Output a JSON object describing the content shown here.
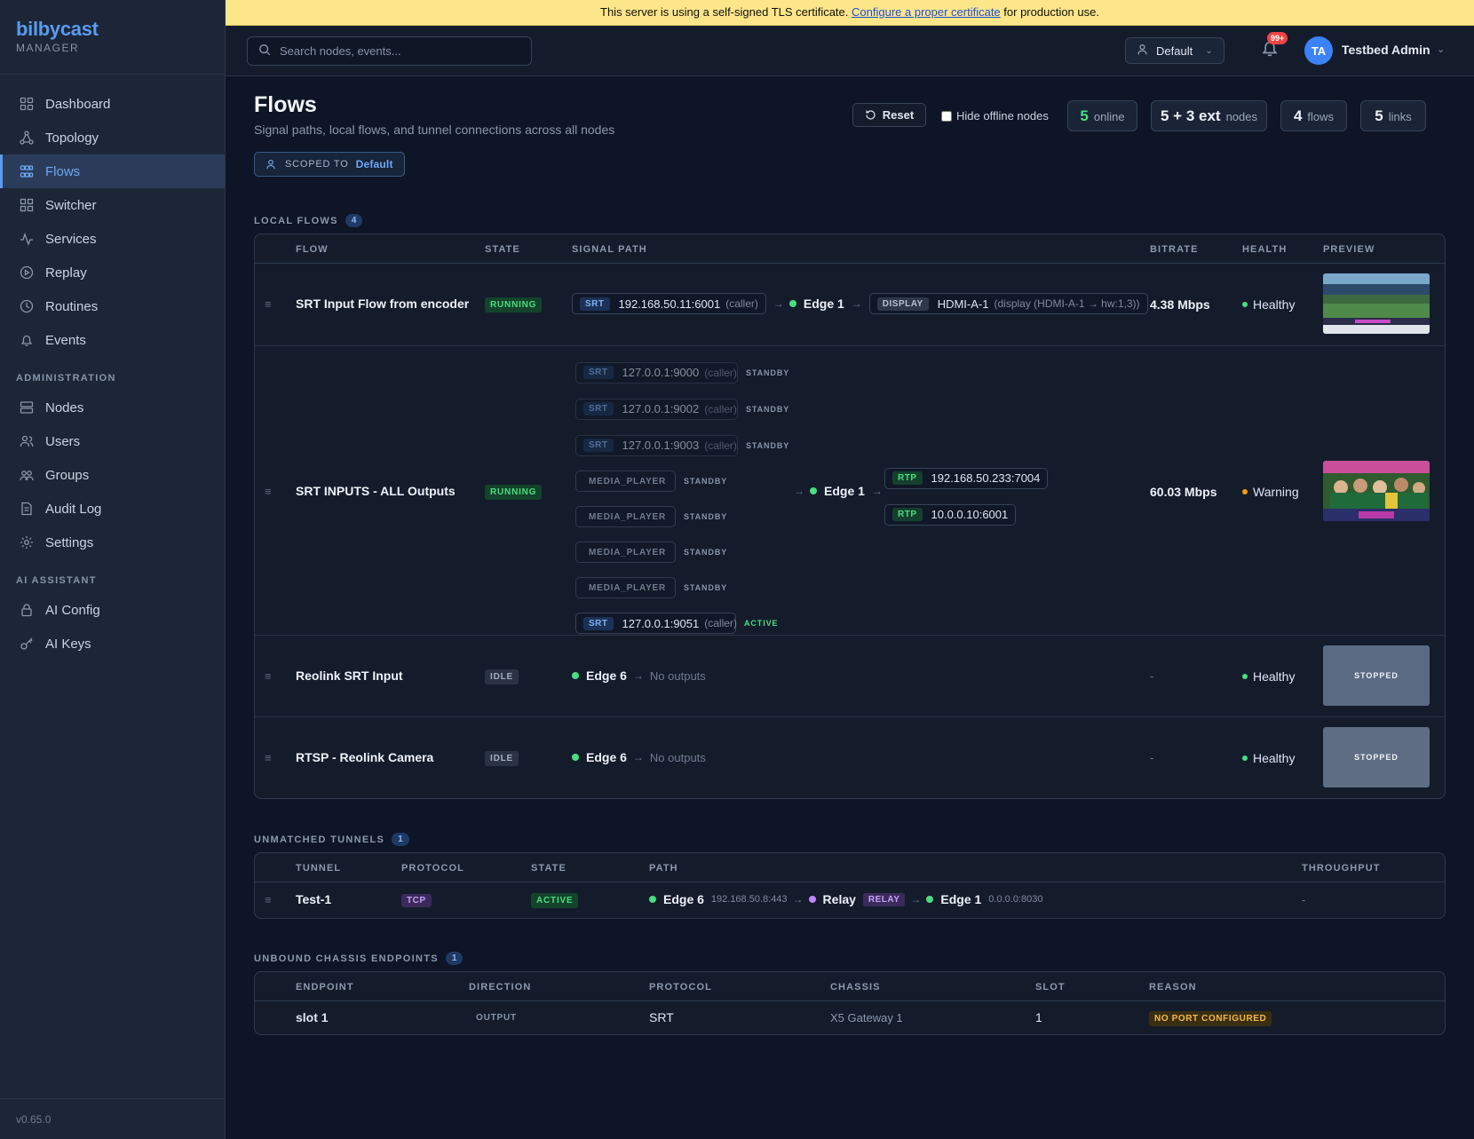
{
  "brand": {
    "name": "bilbycast",
    "sub": "MANAGER"
  },
  "nav": {
    "items": [
      {
        "label": "Dashboard",
        "icon": "dashboard-icon"
      },
      {
        "label": "Topology",
        "icon": "topology-icon"
      },
      {
        "label": "Flows",
        "icon": "flows-icon",
        "active": true
      },
      {
        "label": "Switcher",
        "icon": "switcher-icon"
      },
      {
        "label": "Services",
        "icon": "services-icon"
      },
      {
        "label": "Replay",
        "icon": "replay-icon"
      },
      {
        "label": "Routines",
        "icon": "clock-icon"
      },
      {
        "label": "Events",
        "icon": "bell-icon"
      }
    ],
    "admin_label": "ADMINISTRATION",
    "admin_items": [
      {
        "label": "Nodes",
        "icon": "server-icon"
      },
      {
        "label": "Users",
        "icon": "users-icon"
      },
      {
        "label": "Groups",
        "icon": "groups-icon"
      },
      {
        "label": "Audit Log",
        "icon": "document-icon"
      },
      {
        "label": "Settings",
        "icon": "gear-icon"
      }
    ],
    "ai_label": "AI ASSISTANT",
    "ai_items": [
      {
        "label": "AI Config",
        "icon": "lock-icon"
      },
      {
        "label": "AI Keys",
        "icon": "key-icon"
      }
    ],
    "version": "v0.65.0"
  },
  "banner": {
    "before": "This server is using a self-signed TLS certificate.",
    "link": "Configure a proper certificate",
    "after": "for production use."
  },
  "topbar": {
    "search_placeholder": "Search nodes, events...",
    "scope": "Default",
    "notifications": "99+",
    "avatar_initials": "TA",
    "user_name": "Testbed Admin"
  },
  "header": {
    "title": "Flows",
    "subtitle": "Signal paths, local flows, and tunnel connections across all nodes",
    "scoped_label": "SCOPED TO",
    "scoped_value": "Default",
    "reset_label": "Reset",
    "hide_offline_label": "Hide offline nodes",
    "stats": [
      {
        "n": "5",
        "l": "online"
      },
      {
        "n": "5 + 3 ext",
        "l": "nodes"
      },
      {
        "n": "4",
        "l": "flows"
      },
      {
        "n": "5",
        "l": "links"
      }
    ]
  },
  "local_flows": {
    "label": "LOCAL FLOWS",
    "count": "4",
    "columns": [
      "FLOW",
      "STATE",
      "SIGNAL PATH",
      "BITRATE",
      "HEALTH",
      "PREVIEW"
    ],
    "rows": [
      {
        "name": "SRT Input Flow from encoder",
        "state": "RUNNING",
        "input_tag": "SRT",
        "input_addr": "192.168.50.11:6001",
        "input_mode": "(caller)",
        "node": "Edge 1",
        "output_tag": "DISPLAY",
        "output_addr": "HDMI-A-1",
        "output_sub": "(display (HDMI-A-1 → hw:1,3))",
        "bitrate": "4.38 Mbps",
        "health": "Healthy"
      },
      {
        "name": "SRT INPUTS - ALL Outputs",
        "state": "RUNNING",
        "inputs": [
          {
            "tag": "SRT",
            "addr": "127.0.0.1:9000",
            "mode": "(caller)",
            "status": "STANDBY"
          },
          {
            "tag": "SRT",
            "addr": "127.0.0.1:9002",
            "mode": "(caller)",
            "status": "STANDBY"
          },
          {
            "tag": "SRT",
            "addr": "127.0.0.1:9003",
            "mode": "(caller)",
            "status": "STANDBY"
          },
          {
            "tag": "MEDIA_PLAYER",
            "status": "STANDBY"
          },
          {
            "tag": "MEDIA_PLAYER",
            "status": "STANDBY"
          },
          {
            "tag": "MEDIA_PLAYER",
            "status": "STANDBY"
          },
          {
            "tag": "MEDIA_PLAYER",
            "status": "STANDBY"
          },
          {
            "tag": "SRT",
            "addr": "127.0.0.1:9051",
            "mode": "(caller)",
            "status": "ACTIVE"
          }
        ],
        "node": "Edge 1",
        "outputs": [
          {
            "tag": "RTP",
            "addr": "192.168.50.233:7004"
          },
          {
            "tag": "RTP",
            "addr": "10.0.0.10:6001"
          }
        ],
        "bitrate": "60.03 Mbps",
        "health": "Warning"
      },
      {
        "name": "Reolink SRT Input",
        "state": "IDLE",
        "node": "Edge 6",
        "no_outputs": "No outputs",
        "bitrate": "-",
        "health": "Healthy",
        "preview": "STOPPED"
      },
      {
        "name": "RTSP - Reolink Camera",
        "state": "IDLE",
        "node": "Edge 6",
        "no_outputs": "No outputs",
        "bitrate": "-",
        "health": "Healthy",
        "preview": "STOPPED"
      }
    ]
  },
  "tunnels": {
    "label": "UNMATCHED TUNNELS",
    "count": "1",
    "columns": [
      "TUNNEL",
      "PROTOCOL",
      "STATE",
      "PATH",
      "THROUGHPUT"
    ],
    "row": {
      "name": "Test-1",
      "protocol": "TCP",
      "state": "ACTIVE",
      "from_node": "Edge 6",
      "from_addr": "192.168.50.8:443",
      "relay": "Relay",
      "relay_tag": "RELAY",
      "to_node": "Edge 1",
      "to_addr": "0.0.0.0:8030",
      "throughput": "-"
    }
  },
  "chassis": {
    "label": "UNBOUND CHASSIS ENDPOINTS",
    "count": "1",
    "columns": [
      "ENDPOINT",
      "DIRECTION",
      "PROTOCOL",
      "CHASSIS",
      "SLOT",
      "REASON"
    ],
    "row": {
      "endpoint": "slot 1",
      "direction": "OUTPUT",
      "protocol": "SRT",
      "chassis": "X5 Gateway 1",
      "slot": "1",
      "reason": "NO PORT CONFIGURED"
    }
  }
}
